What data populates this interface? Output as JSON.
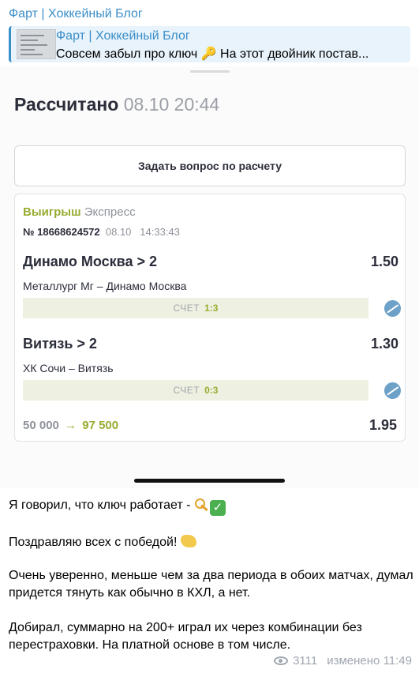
{
  "channel": {
    "name": "Фарт | Хоккейный Блог"
  },
  "reply": {
    "author": "Фарт | Хоккейный Блог",
    "text": "Совсем забыл про ключ 🔑  На этот двойник постав..."
  },
  "screenshot": {
    "status": "Рассчитано",
    "datetime": "08.10 20:44",
    "ask_button": "Задать вопрос по расчету",
    "ticket": {
      "result": "Выигрыш",
      "type": "Экспресс",
      "number": "№ 18668624572",
      "date": "08.10",
      "time": "14:33:43",
      "bets": [
        {
          "selection": "Динамо Москва > 2",
          "odds": "1.50",
          "match": "Металлург Мг – Динамо Москва",
          "score_label": "СЧЕТ",
          "score": "1:3"
        },
        {
          "selection": "Витязь > 2",
          "odds": "1.30",
          "match": "ХК Сочи – Витязь",
          "score_label": "СЧЕТ",
          "score": "0:3"
        }
      ],
      "stake": "50 000",
      "arrow": "→",
      "payout": "97 500",
      "total_odds": "1.95"
    }
  },
  "message": {
    "line1": "Я говорил, что ключ работает - ",
    "line2": "Поздравляю всех с победой! ",
    "para3": "Очень уверенно, меньше чем за два периода в обоих матчах, думал придется тянуть как обычно в КХЛ, а нет.",
    "para4": "Добирал, суммарно на 200+ играл их через комбинации без перестраховки. На платной основе в том числе."
  },
  "footer": {
    "views": "3111",
    "edited": "изменено 11:49"
  }
}
